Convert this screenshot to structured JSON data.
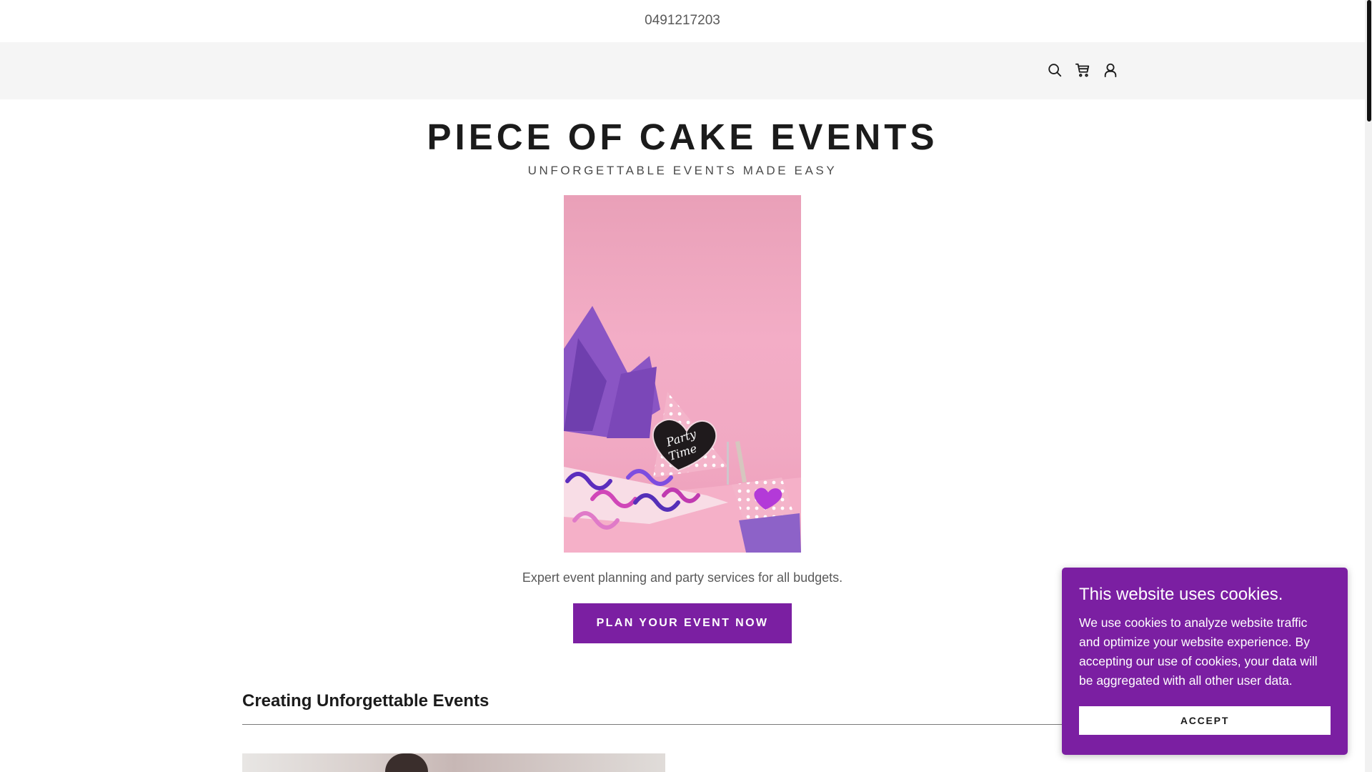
{
  "topbar": {
    "phone": "0491217203"
  },
  "nav": {
    "icons": [
      "search-icon",
      "cart-icon",
      "account-icon"
    ]
  },
  "hero": {
    "title": "PIECE OF CAKE EVENTS",
    "tagline": "UNFORGETTABLE EVENTS MADE EASY",
    "image_text": "Party Time",
    "description": "Expert event planning and party services for all budgets.",
    "cta_label": "PLAN YOUR EVENT NOW"
  },
  "section": {
    "heading": "Creating Unforgettable Events"
  },
  "cookie_banner": {
    "title": "This website uses cookies.",
    "text": "We use cookies to analyze website traffic and optimize your website experience. By accepting our use of cookies, your data will be aggregated with all other user data.",
    "accept_label": "ACCEPT"
  },
  "colors": {
    "accent": "#7b1fa2",
    "nav_background": "#f5f5f5",
    "text_dark": "#1b1b1b",
    "text_muted": "#595959"
  }
}
